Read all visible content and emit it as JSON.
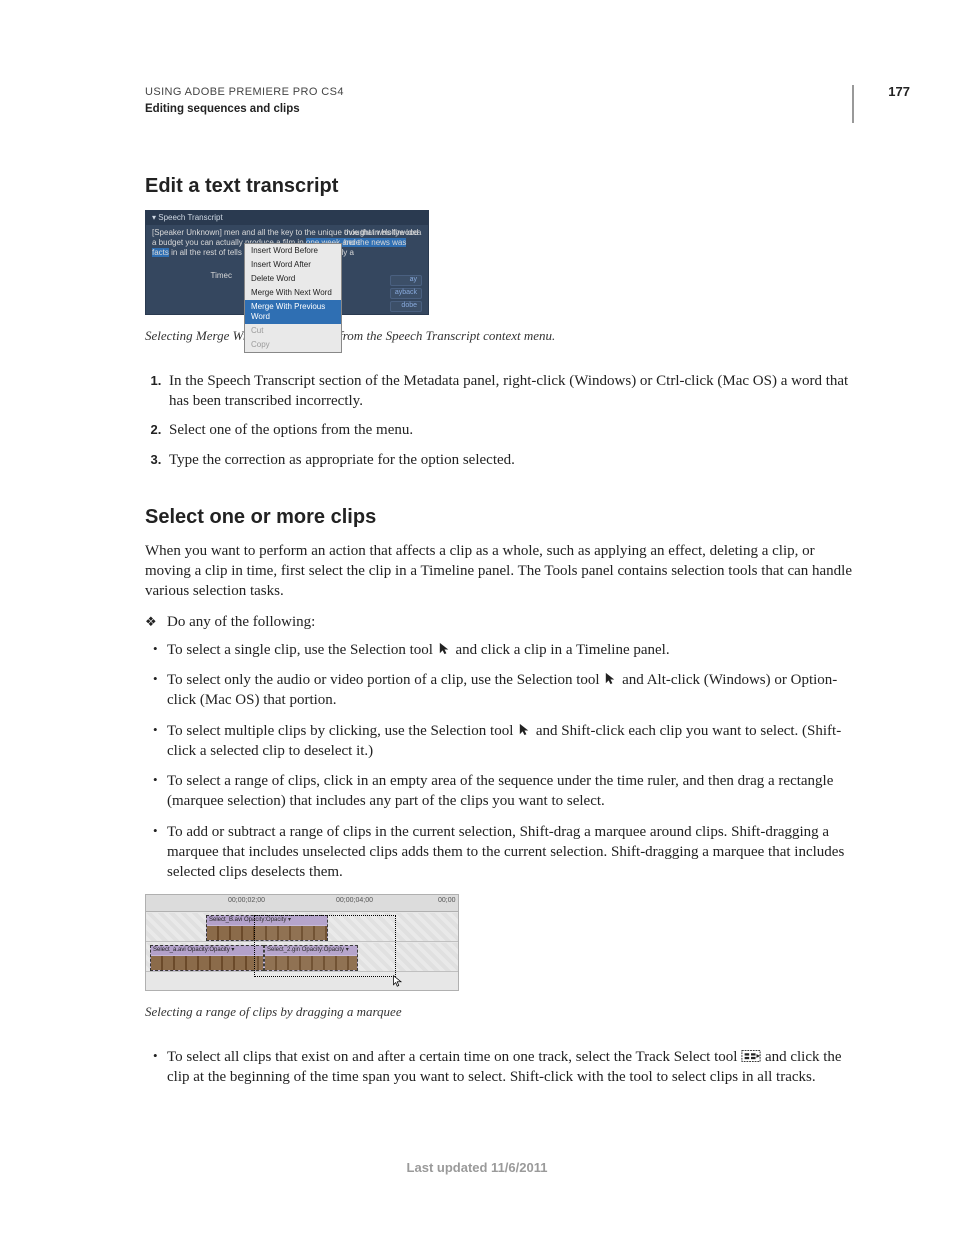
{
  "header": {
    "line1": "USING ADOBE PREMIERE PRO CS4",
    "line2": "Editing sequences and clips",
    "page_number": "177"
  },
  "section1": {
    "title": "Edit a text transcript",
    "fig": {
      "panel_title": "Speech Transcript",
      "transcript_text_a": "[Speaker Unknown] men and all the key to the unique thought in Hollywood a budget you can actually produce a film in ",
      "transcript_text_hl": "one week and the news was facts",
      "transcript_text_b": " in all the rest of tells in the in the package actually a",
      "transcript_text_c": "ovie that was the idea here",
      "timecode_label": "Timec",
      "menu": {
        "items": [
          "Insert Word Before",
          "Insert Word After",
          "Delete Word",
          "Merge With Next Word",
          "Merge With Previous Word",
          "Cut",
          "Copy"
        ],
        "selected_index": 4
      },
      "right_tags": [
        "ay",
        "ayback",
        "dobe"
      ]
    },
    "caption": "Selecting Merge With Previous Word from the Speech Transcript context menu.",
    "steps": [
      "In the Speech Transcript section of the Metadata panel, right-click (Windows) or Ctrl-click (Mac OS) a word that has been transcribed incorrectly.",
      "Select one of the options from the menu.",
      "Type the correction as appropriate for the option selected."
    ]
  },
  "section2": {
    "title": "Select one or more clips",
    "intro": "When you want to perform an action that affects a clip as a whole, such as applying an effect, deleting a clip, or moving a clip in time, first select the clip in a Timeline panel. The Tools panel contains selection tools that can handle various selection tasks.",
    "do_any": "Do any of the following:",
    "bullets_a": [
      {
        "pre": "To select a single clip, use the Selection tool ",
        "tool": "selection",
        "post": " and click a clip in a Timeline panel."
      },
      {
        "pre": "To select only the audio or video portion of a clip, use the Selection tool ",
        "tool": "selection",
        "post": " and Alt-click (Windows) or Option-click (Mac OS) that portion."
      },
      {
        "pre": "To select multiple clips by clicking, use the Selection tool ",
        "tool": "selection",
        "post": " and Shift-click each clip you want to select. (Shift-click a selected clip to deselect it.)"
      },
      {
        "text": "To select a range of clips, click in an empty area of the sequence under the time ruler, and then drag a rectangle (marquee selection) that includes any part of the clips you want to select."
      },
      {
        "text": "To add or subtract a range of clips in the current selection, Shift-drag a marquee around clips. Shift-dragging a marquee that includes unselected clips adds them to the current selection. Shift-dragging a marquee that includes selected clips deselects them."
      }
    ],
    "fig2": {
      "ruler_labels": [
        "00;00;02;00",
        "00;00;04;00",
        "00;00"
      ],
      "clip_labels": [
        "Select_B.avi Opacity:Opacity ▾",
        "Select_a.avi Opacity:Opacity ▾",
        "Select_2.gin Opacity:Opacity ▾"
      ]
    },
    "caption2": "Selecting a range of clips by dragging a marquee",
    "bullets_b": [
      {
        "pre": "To select all clips that exist on and after a certain time on one track, select the Track Select tool ",
        "tool": "track-select",
        "post": " and click the clip at the beginning of the time span you want to select. Shift-click with the tool to select clips in all tracks."
      }
    ]
  },
  "footer": {
    "updated": "Last updated 11/6/2011"
  }
}
